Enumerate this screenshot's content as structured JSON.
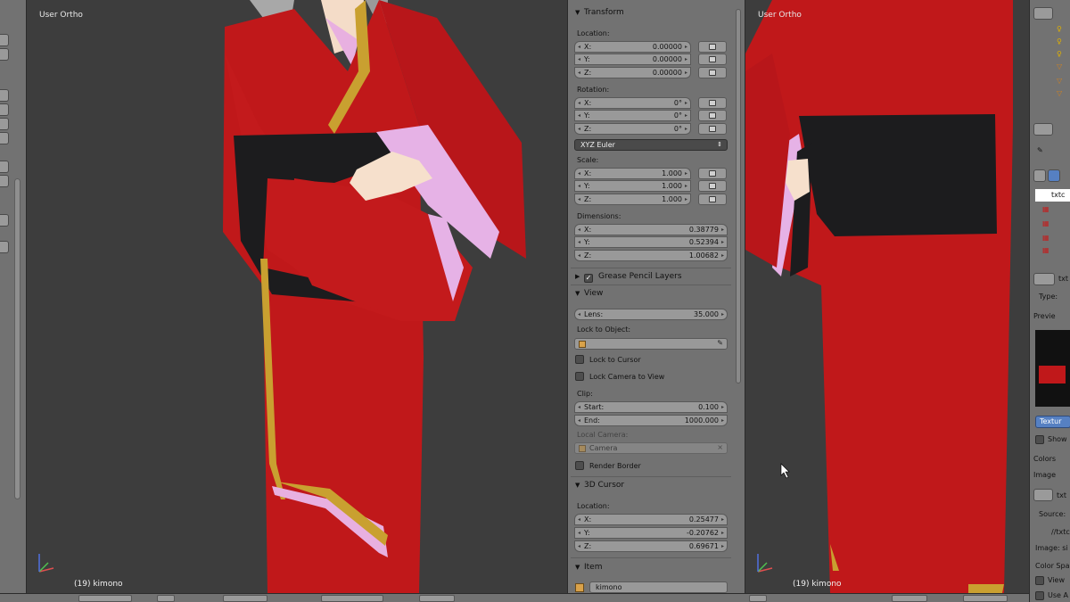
{
  "viewport_left": {
    "view_label": "User Ortho",
    "object_label": "(19) kimono"
  },
  "viewport_right": {
    "view_label": "User Ortho",
    "object_label": "(19) kimono"
  },
  "npanel": {
    "transform": {
      "header": "Transform",
      "location_label": "Location:",
      "location": [
        {
          "axis": "X:",
          "value": "0.00000"
        },
        {
          "axis": "Y:",
          "value": "0.00000"
        },
        {
          "axis": "Z:",
          "value": "0.00000"
        }
      ],
      "rotation_label": "Rotation:",
      "rotation": [
        {
          "axis": "X:",
          "value": "0°"
        },
        {
          "axis": "Y:",
          "value": "0°"
        },
        {
          "axis": "Z:",
          "value": "0°"
        }
      ],
      "rotation_mode": "XYZ Euler",
      "scale_label": "Scale:",
      "scale": [
        {
          "axis": "X:",
          "value": "1.000"
        },
        {
          "axis": "Y:",
          "value": "1.000"
        },
        {
          "axis": "Z:",
          "value": "1.000"
        }
      ],
      "dimensions_label": "Dimensions:",
      "dimensions": [
        {
          "axis": "X:",
          "value": "0.38779"
        },
        {
          "axis": "Y:",
          "value": "0.52394"
        },
        {
          "axis": "Z:",
          "value": "1.00682"
        }
      ]
    },
    "grease_pencil": {
      "header": "Grease Pencil Layers"
    },
    "view": {
      "header": "View",
      "lens_label": "Lens:",
      "lens_value": "35.000",
      "lock_to_object_label": "Lock to Object:",
      "lock_to_cursor": "Lock to Cursor",
      "lock_camera_to_view": "Lock Camera to View",
      "clip_label": "Clip:",
      "clip_start_label": "Start:",
      "clip_start_value": "0.100",
      "clip_end_label": "End:",
      "clip_end_value": "1000.000",
      "local_camera_label": "Local Camera:",
      "local_camera_value": "Camera",
      "render_border": "Render Border"
    },
    "cursor3d": {
      "header": "3D Cursor",
      "location_label": "Location:",
      "location": [
        {
          "axis": "X:",
          "value": "0.25477"
        },
        {
          "axis": "Y:",
          "value": "-0.20762"
        },
        {
          "axis": "Z:",
          "value": "0.69671"
        }
      ]
    },
    "item": {
      "header": "Item",
      "name": "kimono"
    }
  },
  "rightpanel": {
    "texture_slot": "txtc",
    "texture_name": "txt",
    "type_label": "Type:",
    "preview_header": "Previe",
    "texture_button": "Textur",
    "show_label": "Show",
    "colors_header": "Colors",
    "image_header": "Image",
    "image_name": "txt",
    "source_label": "Source:",
    "file_path": "//txtc",
    "image_info": "Image: si",
    "color_space": "Color Spa",
    "view_label": "View",
    "use_label": "Use A"
  },
  "colors": {
    "panel_bg": "#727272",
    "viewport_bg": "#3d3d3d",
    "kimono_red": "#c0181a",
    "obi_black": "#1c1c1e",
    "lining_pink": "#e8b0e0",
    "accent_blue": "#5680c2"
  }
}
